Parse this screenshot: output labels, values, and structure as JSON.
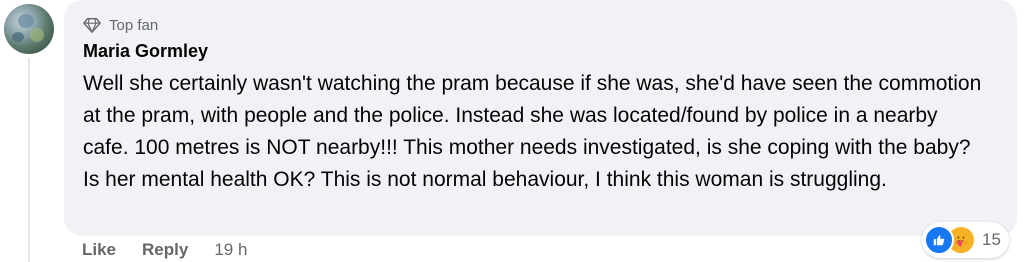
{
  "comment": {
    "badge": "Top fan",
    "author": "Maria Gormley",
    "text": "Well she certainly wasn't watching the pram because if she was, she'd have seen the commotion at the pram, with people and the police. Instead she was located/found by police in a nearby cafe. 100 metres is NOT nearby!!! This mother needs investigated, is she coping with the baby? Is her mental health OK? This is not normal behaviour, I think this woman is struggling."
  },
  "actions": {
    "like_label": "Like",
    "reply_label": "Reply",
    "timestamp": "19 h"
  },
  "reactions": {
    "icons": [
      "like-icon",
      "care-icon"
    ],
    "count": "15"
  },
  "colors": {
    "bubble": "#f0f2f5",
    "like_blue": "#1877f2",
    "care_yellow": "#f7b125",
    "secondary_text": "#65676b"
  }
}
